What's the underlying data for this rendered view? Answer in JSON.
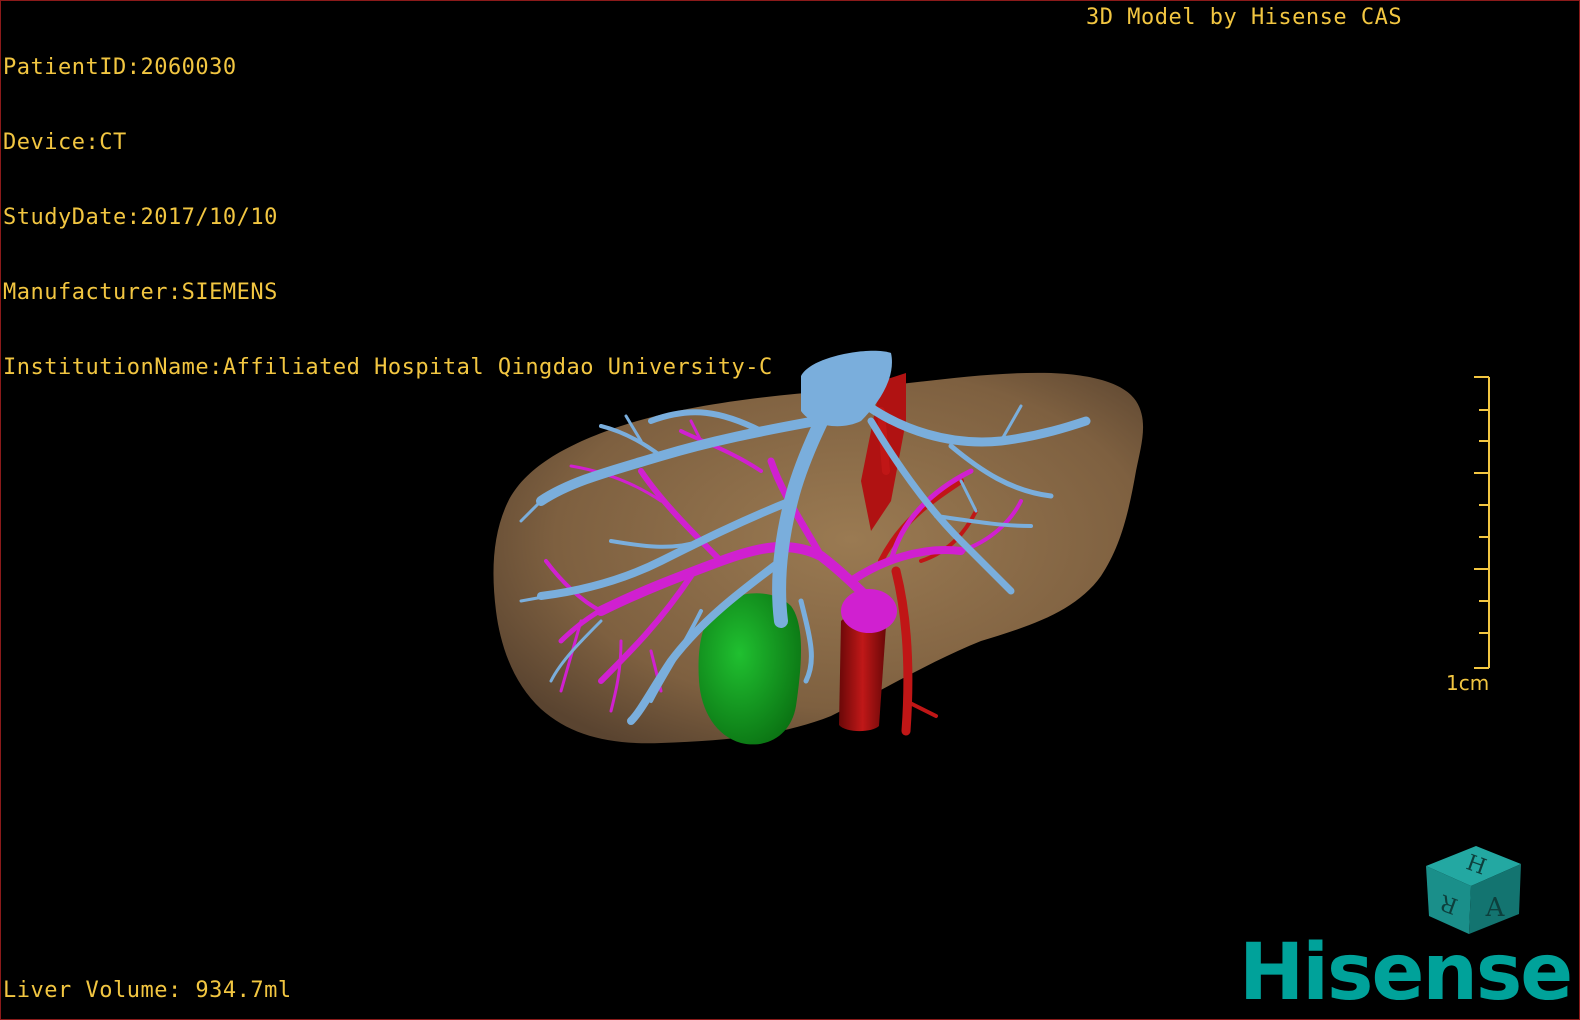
{
  "dicom_info": {
    "patient_id": "PatientID:2060030",
    "device": "Device:CT",
    "study_date": "StudyDate:2017/10/10",
    "manufacturer": "Manufacturer:SIEMENS",
    "institution": "InstitutionName:Affiliated Hospital Qingdao University-C"
  },
  "credit": "3D Model by Hisense CAS",
  "liver_volume": "Liver Volume: 934.7ml",
  "scale_bar": {
    "label": "1cm"
  },
  "orientation_cube": {
    "faces": [
      "H",
      "R",
      "A"
    ],
    "color": "#1a8f8a"
  },
  "brand": {
    "name": "Hisense",
    "color": "#00a29a"
  },
  "colors": {
    "text": "#f2c641",
    "liver": "#8a6a45",
    "hepatic_vein": "#7aaedc",
    "portal_vein": "#d020d0",
    "artery": "#b01010",
    "gallbladder": "#10a020",
    "border": "#8b1a1a"
  },
  "model_parts": [
    "liver",
    "hepatic-vein",
    "portal-vein",
    "artery",
    "gallbladder"
  ]
}
